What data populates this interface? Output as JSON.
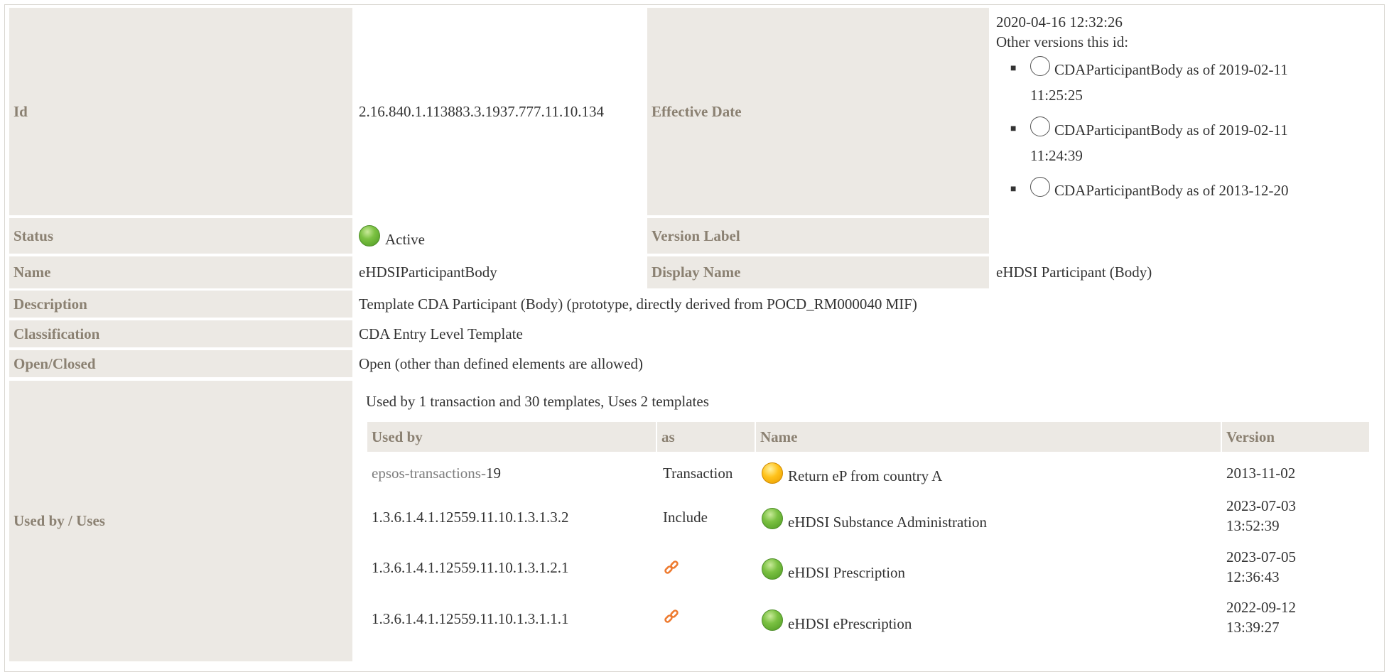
{
  "fields": {
    "id_label": "Id",
    "id_value": "2.16.840.1.113883.3.1937.777.11.10.134",
    "effective_label": "Effective Date",
    "effective_value": "2020-04-16 12:32:26",
    "other_versions_label": "Other versions this id:",
    "other_versions": [
      {
        "line1": "CDAParticipantBody as of 2019-02-11",
        "line2": "11:25:25"
      },
      {
        "line1": "CDAParticipantBody as of 2019-02-11",
        "line2": "11:24:39"
      },
      {
        "line1": "CDAParticipantBody as of 2013-12-20",
        "line2": ""
      }
    ],
    "status_label": "Status",
    "status_value": "Active",
    "version_label_label": "Version Label",
    "version_label_value": "",
    "name_label": "Name",
    "name_value": "eHDSIParticipantBody",
    "display_name_label": "Display Name",
    "display_name_value": "eHDSI Participant (Body)",
    "description_label": "Description",
    "description_value": "Template CDA Participant (Body) (prototype, directly derived from POCD_RM000040 MIF)",
    "classification_label": "Classification",
    "classification_value": "CDA Entry Level Template",
    "open_closed_label": "Open/Closed",
    "open_closed_value": "Open (other than defined elements are allowed)",
    "used_by_label": "Used by / Uses"
  },
  "usage": {
    "summary": "Used by 1 transaction and 30 templates, Uses 2 templates",
    "headers": {
      "used_by": "Used by",
      "as": "as",
      "name": "Name",
      "version": "Version"
    },
    "rows": [
      {
        "used_by_link": "epsos-transactions-",
        "used_by_suffix": "19",
        "as": "Transaction",
        "status": "yellow",
        "name": "Return eP from country A",
        "version1": "2013-11-02",
        "version2": ""
      },
      {
        "used_by_link": "",
        "used_by_suffix": "1.3.6.1.4.1.12559.11.10.1.3.1.3.2",
        "as": "Include",
        "status": "green",
        "name": "eHDSI Substance Administration",
        "version1": "2023-07-03",
        "version2": "13:52:39"
      },
      {
        "used_by_link": "",
        "used_by_suffix": "1.3.6.1.4.1.12559.11.10.1.3.1.2.1",
        "as": "",
        "as_icon": "link-icon",
        "status": "green",
        "name": "eHDSI Prescription",
        "version1": "2023-07-05",
        "version2": "12:36:43"
      },
      {
        "used_by_link": "",
        "used_by_suffix": "1.3.6.1.4.1.12559.11.10.1.3.1.1.1",
        "as": "",
        "as_icon": "link-icon",
        "status": "green",
        "name": "eHDSI ePrescription",
        "version1": "2022-09-12",
        "version2": "13:39:27"
      }
    ]
  },
  "colors": {
    "label_bg": "#ece9e4",
    "label_text": "#8b8172",
    "active_green": "#7bc142",
    "pending_yellow": "#ffc21a",
    "link_orange": "#ee7b30"
  }
}
